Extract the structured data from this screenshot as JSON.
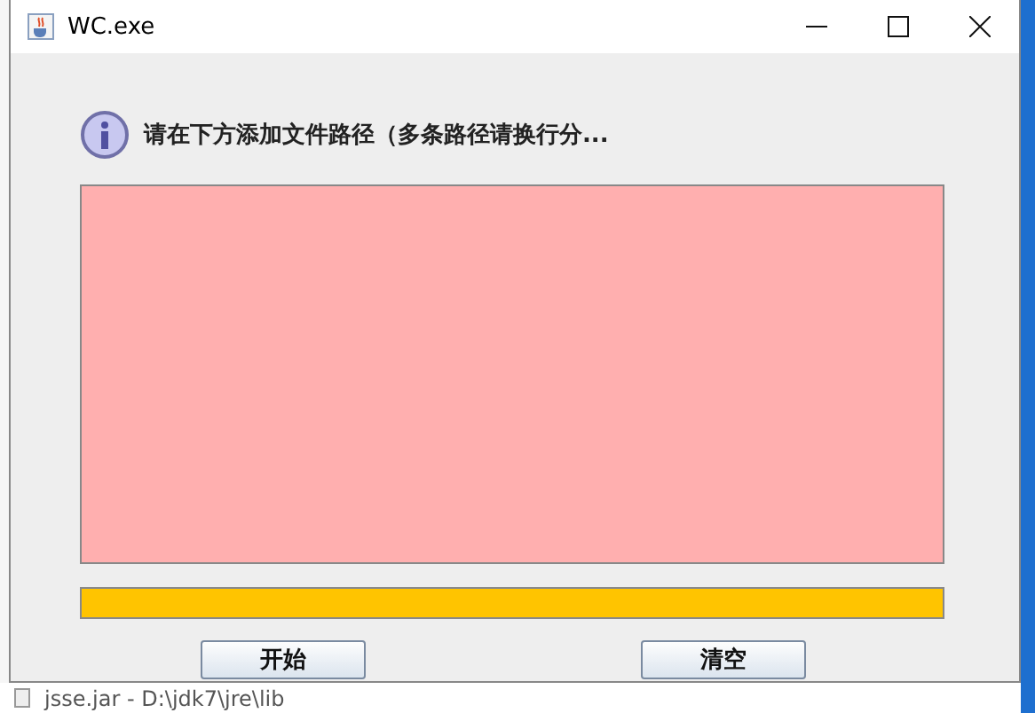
{
  "window": {
    "title": "WC.exe"
  },
  "message": "请在下方添加文件路径（多条路径请换行分...",
  "progress": {
    "level": 1
  },
  "buttons": [
    {
      "label": "开始"
    },
    {
      "label": "清空"
    }
  ],
  "background_window": {
    "status_text": "jsse.jar - D:\\jdk7\\jre\\lib"
  }
}
